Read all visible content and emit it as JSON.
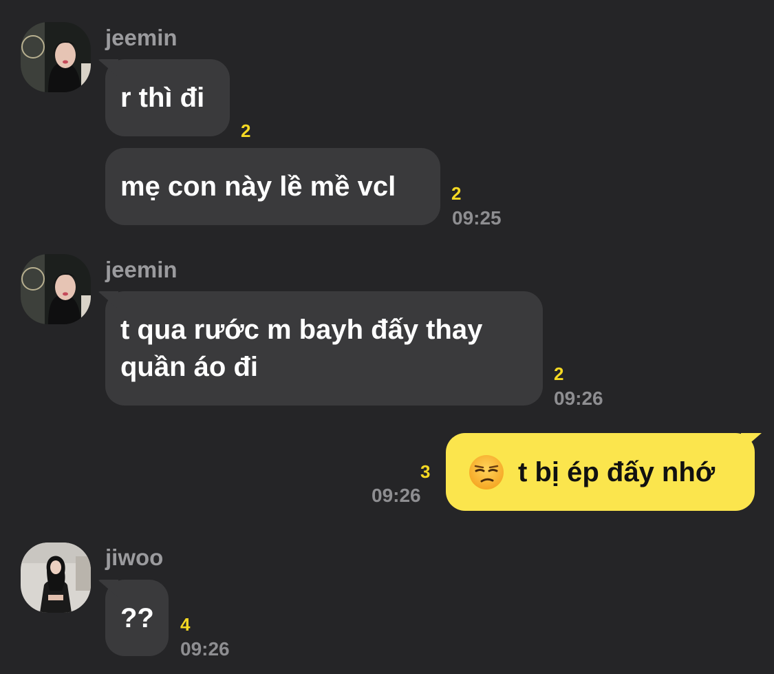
{
  "messages": [
    {
      "sender": "jeemin",
      "bubbles": [
        {
          "text": "r thì đi",
          "unread": "2"
        },
        {
          "text": "mẹ con này lề mề vcl",
          "unread": "2",
          "time": "09:25"
        }
      ]
    },
    {
      "sender": "jeemin",
      "bubbles": [
        {
          "line1": "t qua rước m bayh đấy thay",
          "line2": "quần áo đi",
          "unread": "2",
          "time": "09:26"
        }
      ]
    },
    {
      "sender": "me",
      "bubbles": [
        {
          "text": "t bị ép đấy nhớ",
          "emoji": "unamused-face-icon",
          "unread": "3",
          "time": "09:26"
        }
      ]
    },
    {
      "sender": "jiwoo",
      "bubbles": [
        {
          "text": "??",
          "unread": "4",
          "time": "09:26"
        }
      ]
    }
  ],
  "colors": {
    "background": "#252527",
    "incoming_bubble": "#3a3a3c",
    "outgoing_bubble": "#fbe54d",
    "unread_count": "#f5d923",
    "timestamp": "#8e8e91",
    "sender_name": "#9b9b9e"
  }
}
